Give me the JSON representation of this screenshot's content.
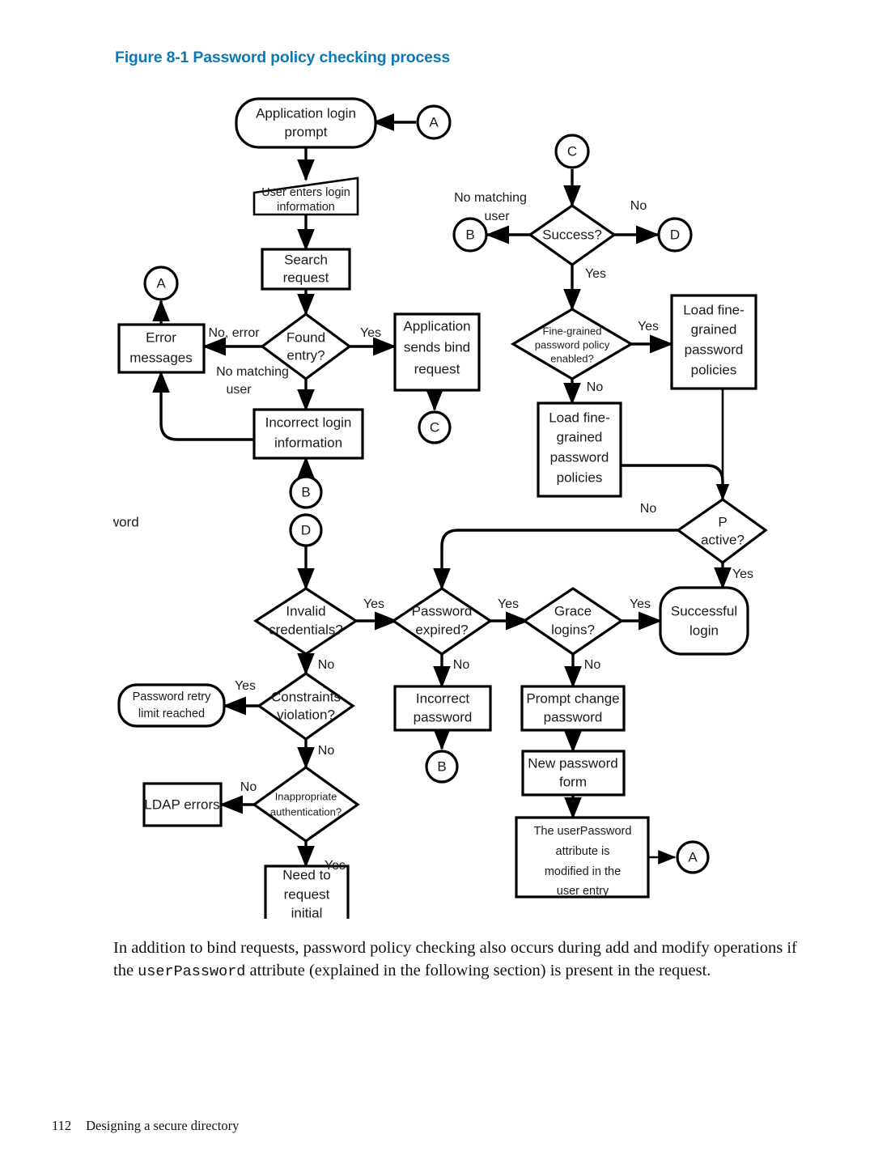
{
  "figure": {
    "title": "Figure 8-1 Password policy checking process",
    "title_color": "#0b79b8"
  },
  "body": {
    "para_part1": "In addition to bind requests, password policy checking also occurs during add and modify operations if the ",
    "para_mono": "userPassword",
    "para_part2": " attribute (explained in the following section) is present in the request."
  },
  "footer": {
    "page_number": "112",
    "chapter": "Designing a secure directory"
  },
  "chart_data": {
    "type": "diagram",
    "title": "Password policy checking process",
    "nodes": [
      {
        "id": "app_login_prompt",
        "shape": "rounded",
        "label": "Application login prompt"
      },
      {
        "id": "conn_a_top",
        "shape": "connector",
        "label": "A"
      },
      {
        "id": "user_enters",
        "shape": "trapezoid",
        "label": "User enters login information"
      },
      {
        "id": "search_request",
        "shape": "rect",
        "label": "Search request"
      },
      {
        "id": "conn_a_left",
        "shape": "connector",
        "label": "A"
      },
      {
        "id": "found_entry",
        "shape": "diamond",
        "label": "Found entry?"
      },
      {
        "id": "error_messages",
        "shape": "rect",
        "label": "Error messages"
      },
      {
        "id": "app_sends_bind",
        "shape": "rect",
        "label": "Application sends bind request"
      },
      {
        "id": "conn_c_out",
        "shape": "connector",
        "label": "C"
      },
      {
        "id": "incorrect_login",
        "shape": "rect",
        "label": "Incorrect login information"
      },
      {
        "id": "conn_b_in",
        "shape": "connector",
        "label": "B"
      },
      {
        "id": "conn_d_in",
        "shape": "connector",
        "label": "D"
      },
      {
        "id": "conn_c_in",
        "shape": "connector",
        "label": "C"
      },
      {
        "id": "success",
        "shape": "diamond",
        "label": "Success?"
      },
      {
        "id": "conn_b_out",
        "shape": "connector",
        "label": "B"
      },
      {
        "id": "conn_d_out",
        "shape": "connector",
        "label": "D"
      },
      {
        "id": "fgpp_enabled",
        "shape": "diamond",
        "label": "Fine-grained password policy enabled?"
      },
      {
        "id": "load_fgpp_right",
        "shape": "rect",
        "label": "Load fine-grained password policies"
      },
      {
        "id": "load_fgpp_left",
        "shape": "rect",
        "label": "Load fine-grained password policies"
      },
      {
        "id": "password_active",
        "shape": "diamond",
        "label": "Password active?"
      },
      {
        "id": "invalid_credentials",
        "shape": "diamond",
        "label": "Invalid credentials?"
      },
      {
        "id": "password_expired",
        "shape": "diamond",
        "label": "Password expired?"
      },
      {
        "id": "grace_logins",
        "shape": "diamond",
        "label": "Grace logins?"
      },
      {
        "id": "successful_login",
        "shape": "rounded",
        "label": "Successful login"
      },
      {
        "id": "constraints_violation",
        "shape": "diamond",
        "label": "Constraints violation?"
      },
      {
        "id": "password_retry_limit",
        "shape": "rounded",
        "label": "Password retry limit reached"
      },
      {
        "id": "incorrect_password",
        "shape": "rect",
        "label": "Incorrect password"
      },
      {
        "id": "conn_b_bottom",
        "shape": "connector",
        "label": "B"
      },
      {
        "id": "prompt_change_password",
        "shape": "rect",
        "label": "Prompt change password"
      },
      {
        "id": "new_password_form",
        "shape": "rect",
        "label": "New password form"
      },
      {
        "id": "userpassword_modified",
        "shape": "rect",
        "label": "The userPassword attribute is modified in the user entry"
      },
      {
        "id": "conn_a_bottom",
        "shape": "connector",
        "label": "A"
      },
      {
        "id": "inappropriate_auth",
        "shape": "diamond",
        "label": "Inappropriate authentication?"
      },
      {
        "id": "ldap_errors",
        "shape": "rect",
        "label": "LDAP errors"
      },
      {
        "id": "need_request_initial",
        "shape": "rect",
        "label": "Need to request initial"
      }
    ],
    "edges": [
      {
        "from": "conn_a_top",
        "to": "app_login_prompt",
        "label": ""
      },
      {
        "from": "app_login_prompt",
        "to": "user_enters",
        "label": ""
      },
      {
        "from": "user_enters",
        "to": "search_request",
        "label": ""
      },
      {
        "from": "search_request",
        "to": "found_entry",
        "label": ""
      },
      {
        "from": "found_entry",
        "to": "error_messages",
        "label": "No, error"
      },
      {
        "from": "found_entry",
        "to": "app_sends_bind",
        "label": "Yes"
      },
      {
        "from": "found_entry",
        "to": "incorrect_login",
        "label": "No matching user"
      },
      {
        "from": "error_messages",
        "to": "conn_a_left",
        "label": ""
      },
      {
        "from": "app_sends_bind",
        "to": "conn_c_out",
        "label": ""
      },
      {
        "from": "incorrect_login",
        "to": "error_messages",
        "label": ""
      },
      {
        "from": "conn_b_in",
        "to": "incorrect_login",
        "label": ""
      },
      {
        "from": "conn_c_in",
        "to": "success",
        "label": ""
      },
      {
        "from": "success",
        "to": "conn_b_out",
        "label": "No matching user"
      },
      {
        "from": "success",
        "to": "conn_d_out",
        "label": "No"
      },
      {
        "from": "success",
        "to": "fgpp_enabled",
        "label": "Yes"
      },
      {
        "from": "fgpp_enabled",
        "to": "load_fgpp_right",
        "label": "Yes"
      },
      {
        "from": "fgpp_enabled",
        "to": "load_fgpp_left",
        "label": "No"
      },
      {
        "from": "load_fgpp_right",
        "to": "password_active",
        "label": ""
      },
      {
        "from": "load_fgpp_left",
        "to": "password_active",
        "label": ""
      },
      {
        "from": "password_active",
        "to": "password_expired",
        "label": "No"
      },
      {
        "from": "password_active",
        "to": "successful_login",
        "label": "Yes"
      },
      {
        "from": "conn_d_in",
        "to": "invalid_credentials",
        "label": ""
      },
      {
        "from": "invalid_credentials",
        "to": "password_expired",
        "label": "Yes"
      },
      {
        "from": "invalid_credentials",
        "to": "constraints_violation",
        "label": "No"
      },
      {
        "from": "password_expired",
        "to": "grace_logins",
        "label": "Yes"
      },
      {
        "from": "password_expired",
        "to": "incorrect_password",
        "label": "No"
      },
      {
        "from": "grace_logins",
        "to": "successful_login",
        "label": "Yes"
      },
      {
        "from": "grace_logins",
        "to": "prompt_change_password",
        "label": "No"
      },
      {
        "from": "constraints_violation",
        "to": "password_retry_limit",
        "label": "Yes"
      },
      {
        "from": "constraints_violation",
        "to": "inappropriate_auth",
        "label": "No"
      },
      {
        "from": "inappropriate_auth",
        "to": "ldap_errors",
        "label": "No"
      },
      {
        "from": "inappropriate_auth",
        "to": "need_request_initial",
        "label": "Yes"
      },
      {
        "from": "incorrect_password",
        "to": "conn_b_bottom",
        "label": ""
      },
      {
        "from": "prompt_change_password",
        "to": "new_password_form",
        "label": ""
      },
      {
        "from": "new_password_form",
        "to": "userpassword_modified",
        "label": ""
      },
      {
        "from": "userpassword_modified",
        "to": "conn_a_bottom",
        "label": ""
      }
    ]
  },
  "nodes": {
    "app_login_prompt_l1": "Application login",
    "app_login_prompt_l2": "prompt",
    "conn_a_top": "A",
    "user_enters_l1": "User enters login",
    "user_enters_l2": "information",
    "search_request_l1": "Search",
    "search_request_l2": "request",
    "conn_a_left": "A",
    "found_entry_l1": "Found",
    "found_entry_l2": "entry?",
    "error_messages_l1": "Error",
    "error_messages_l2": "messages",
    "app_sends_bind_l1": "Application",
    "app_sends_bind_l2": "sends bind",
    "app_sends_bind_l3": "request",
    "conn_c_out": "C",
    "incorrect_login_l1": "Incorrect login",
    "incorrect_login_l2": "information",
    "conn_b_in": "B",
    "conn_d_in": "D",
    "conn_c_in": "C",
    "success": "Success?",
    "conn_b_out": "B",
    "conn_d_out": "D",
    "fgpp_l1": "Fine-grained",
    "fgpp_l2": "password policy",
    "fgpp_l3": "enabled?",
    "load_r_l1": "Load fine-",
    "load_r_l2": "grained",
    "load_r_l3": "password",
    "load_r_l4": "policies",
    "load_l_l1": "Load fine-",
    "load_l_l2": "grained",
    "load_l_l3": "password",
    "load_l_l4": "policies",
    "pw_active_l1": "Password",
    "pw_active_l2": "active?",
    "invalid_l1": "Invalid",
    "invalid_l2": "credentials?",
    "pw_expired_l1": "Password",
    "pw_expired_l2": "expired?",
    "grace_l1": "Grace",
    "grace_l2": "logins?",
    "success_login_l1": "Successful",
    "success_login_l2": "login",
    "constraints_l1": "Constraints",
    "constraints_l2": "violation?",
    "retry_l1": "Password retry",
    "retry_l2": "limit reached",
    "incorrect_pw_l1": "Incorrect",
    "incorrect_pw_l2": "password",
    "conn_b_bottom": "B",
    "prompt_change_l1": "Prompt change",
    "prompt_change_l2": "password",
    "new_pw_form_l1": "New password",
    "new_pw_form_l2": "form",
    "userpw_l1": "The userPassword",
    "userpw_l2": "attribute is",
    "userpw_l3": "modified in the",
    "userpw_l4": "user entry",
    "conn_a_bottom": "A",
    "inappropriate_l1": "Inappropriate",
    "inappropriate_l2": "authentication?",
    "ldap_errors": "LDAP errors",
    "need_req_l1": "Need to",
    "need_req_l2": "request",
    "need_req_l3": "initial"
  },
  "edge_labels": {
    "no_error": "No, error",
    "yes_found": "Yes",
    "no_matching_user_l1": "No matching",
    "no_matching_user_l2": "user",
    "success_no_matching_l1": "No matching",
    "success_no_matching_l2": "user",
    "success_no": "No",
    "success_yes": "Yes",
    "fgpp_yes": "Yes",
    "fgpp_no": "No",
    "pw_active_no": "No",
    "pw_active_yes": "Yes",
    "invalid_yes": "Yes",
    "invalid_no": "No",
    "expired_yes": "Yes",
    "expired_no": "No",
    "grace_yes": "Yes",
    "grace_no": "No",
    "constraints_yes": "Yes",
    "constraints_no": "No",
    "inappropriate_no": "No",
    "inappropriate_yes": "Yes"
  }
}
